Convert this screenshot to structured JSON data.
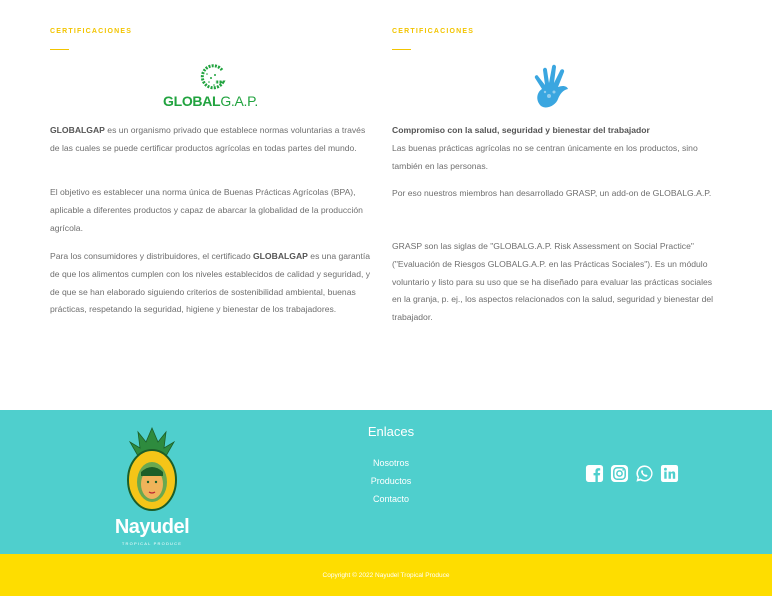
{
  "left": {
    "eyebrow": "CERTIFICACIONES",
    "logo": {
      "text_bold": "GLOBAL",
      "text_thin": "G.A.P.",
      "color": "#21a33f"
    },
    "p1_bold": "GLOBALGAP",
    "p1_rest": " es un organismo privado que establece normas voluntarias a través de las cuales se puede certificar productos agrícolas en todas partes del mundo.",
    "p2": "El objetivo es establecer una norma única de Buenas Prácticas Agrícolas (BPA), aplicable a diferentes productos y capaz de abarcar la globalidad de la producción agrícola.",
    "p3_a": "Para los consumidores y distribuidores, el certificado ",
    "p3_bold": "GLOBALGAP",
    "p3_b": " es una garantía de que los alimentos cumplen con los niveles establecidos de calidad y seguridad, y de que se han elaborado siguiendo criterios de sostenibilidad ambiental, buenas prácticas, respetando la seguridad, higiene y bienestar de los trabajadores."
  },
  "right": {
    "eyebrow": "CERTIFICACIONES",
    "heading": "Compromiso con la salud, seguridad y bienestar del trabajador",
    "p1": "Las buenas prácticas agrícolas no se centran únicamente en los productos, sino también en las personas.",
    "p2": "Por eso nuestros miembros han desarrollado GRASP, un add-on de GLOBALG.A.P.",
    "p3": "GRASP son las siglas de \"GLOBALG.A.P. Risk Assessment on Social Practice\" (\"Evaluación de Riesgos GLOBALG.A.P. en las Prácticas Sociales\"). Es un módulo voluntario y listo para su uso que se ha diseñado para evaluar las prácticas sociales en la granja, p. ej., los aspectos relacionados con la salud, seguridad y bienestar del trabajador."
  },
  "footer": {
    "brand_name": "Nayudel",
    "brand_tagline": "TROPICAL PRODUCE",
    "links_title": "Enlaces",
    "links": [
      "Nosotros",
      "Productos",
      "Contacto"
    ],
    "social": [
      "facebook-icon",
      "instagram-icon",
      "whatsapp-icon",
      "linkedin-icon"
    ],
    "copyright": "Copyright © 2022 Nayudel Tropical Produce"
  },
  "colors": {
    "accent_yellow": "#f2c400",
    "footer_teal": "#4fcfcd",
    "copy_bar": "#fedd00",
    "text_gray": "#6f6f6f"
  }
}
